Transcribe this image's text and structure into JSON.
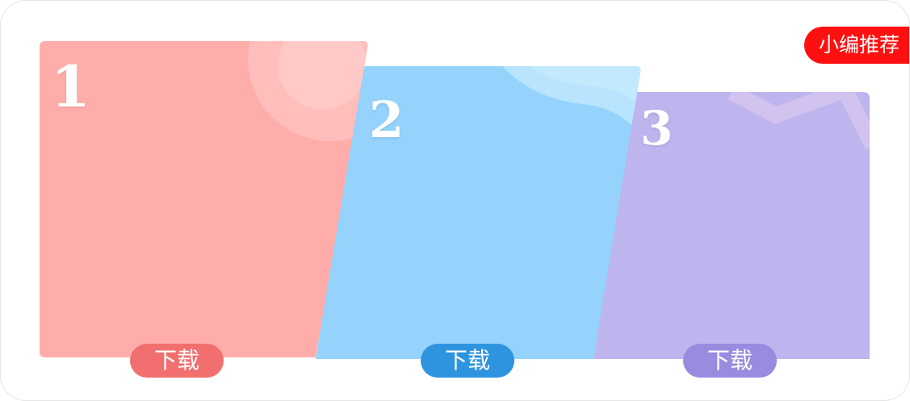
{
  "badge": {
    "label": "小编推荐"
  },
  "cards": [
    {
      "number": "1",
      "download_label": "下载",
      "color": "#ffadab",
      "button_color": "#f26f6f"
    },
    {
      "number": "2",
      "download_label": "下载",
      "color": "#95d3fc",
      "button_color": "#2f94e0"
    },
    {
      "number": "3",
      "download_label": "下载",
      "color": "#beb5ee",
      "button_color": "#9a8be0"
    }
  ]
}
